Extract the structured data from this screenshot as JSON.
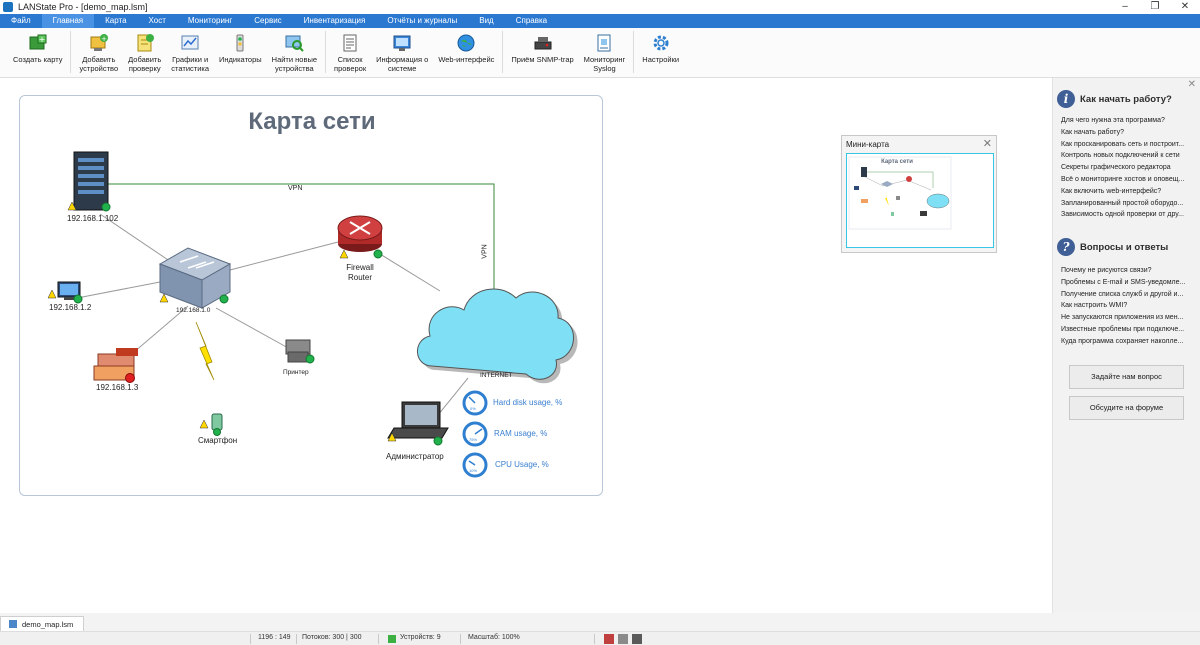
{
  "window": {
    "title": "LANState Pro - [demo_map.lsm]",
    "controls": [
      "–",
      "❐",
      "✕"
    ]
  },
  "menu": [
    "Файл",
    "Главная",
    "Карта",
    "Хост",
    "Мониторинг",
    "Сервис",
    "Инвентаризация",
    "Отчёты и журналы",
    "Вид",
    "Справка"
  ],
  "menu_active": "Главная",
  "ribbon": [
    {
      "label": "Создать карту",
      "icon": "create-map-icon"
    },
    {
      "label": "Добавить\nустройство",
      "icon": "add-device-icon"
    },
    {
      "label": "Добавить\nпроверку",
      "icon": "add-check-icon"
    },
    {
      "label": "Графики и\nстатистика",
      "icon": "charts-icon"
    },
    {
      "label": "Индикаторы",
      "icon": "indicators-icon"
    },
    {
      "label": "Найти новые\nустройства",
      "icon": "find-devices-icon"
    },
    {
      "label": "Список\nпроверок",
      "icon": "check-list-icon"
    },
    {
      "label": "Информация о\nсистеме",
      "icon": "system-info-icon"
    },
    {
      "label": "Web-интерфейс",
      "icon": "web-interface-icon"
    },
    {
      "label": "Приём SNMP-trap",
      "icon": "snmp-trap-icon"
    },
    {
      "label": "Мониторинг\nSyslog",
      "icon": "syslog-icon"
    },
    {
      "label": "Настройки",
      "icon": "settings-icon"
    }
  ],
  "map": {
    "title": "Карта сети",
    "vpn_label": "VPN",
    "vpn_label_vertical": "VPN",
    "nodes": {
      "server": "192.168.1.102",
      "pc": "192.168.1.2",
      "switch": "192.168.1.0",
      "printer_color": "192.168.1.3",
      "smartphone": "Смартфон",
      "printer": "Принтер",
      "firewall_line1": "Firewall",
      "firewall_line2": "Router",
      "internet": "INTERNET",
      "admin": "Администратор"
    },
    "gauges": [
      {
        "label": "Hard disk usage, %",
        "value": "0%"
      },
      {
        "label": "RAM usage, %",
        "value": "75%"
      },
      {
        "label": "CPU Usage, %",
        "value": "10%"
      }
    ]
  },
  "minimap": {
    "title": "Мини-карта",
    "close": "✕",
    "map_title": "Карта сети"
  },
  "help": {
    "close": "✕",
    "start_title": "Как начать работу?",
    "start_links": [
      "Для чего нужна эта программа?",
      "Как начать работу?",
      "Как просканировать сеть и построит...",
      "Контроль новых подключений к сети",
      "Секреты графического редактора",
      "Всё о мониторинге хостов и оповещ...",
      "Как включить web-интерфейс?",
      "Запланированный простой оборудо...",
      "Зависимость одной проверки от дру..."
    ],
    "faq_title": "Вопросы и ответы",
    "faq_links": [
      "Почему не рисуются связи?",
      "Проблемы с E-mail и SMS-уведомле...",
      "Получение списка служб и другой и...",
      "Как настроить WMI?",
      "Не запускаются приложения из мен...",
      "Известные проблемы при подключе...",
      "Куда программа сохраняет наколле..."
    ],
    "ask_button": "Задайте нам вопрос",
    "forum_button": "Обсудите на форуме"
  },
  "tab": {
    "label": "demo_map.lsm"
  },
  "status": {
    "coords": "1196 : 149",
    "threads": "Потоков: 300 | 300",
    "devices": "Устройств: 9",
    "scale": "Масштаб: 100%"
  },
  "colors": {
    "menubar": "#2b78d1",
    "ok_status": "#22b14c",
    "alert_status": "#e02020",
    "cloud": "#7fe0f5",
    "gauge": "#2f7fd0"
  }
}
